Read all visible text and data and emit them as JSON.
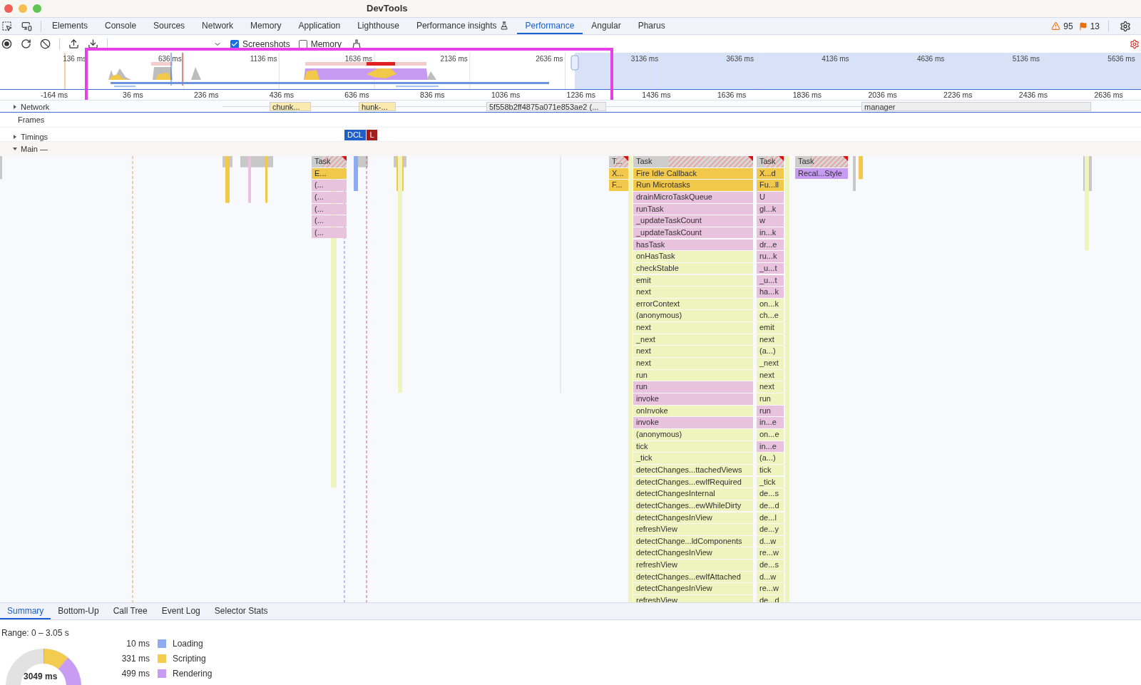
{
  "window": {
    "title": "DevTools"
  },
  "tabs": [
    {
      "label": "Elements",
      "selected": false,
      "kind": "plain"
    },
    {
      "label": "Console",
      "selected": false,
      "kind": "plain"
    },
    {
      "label": "Sources",
      "selected": false,
      "kind": "plain"
    },
    {
      "label": "Network",
      "selected": false,
      "kind": "plain"
    },
    {
      "label": "Memory",
      "selected": false,
      "kind": "plain"
    },
    {
      "label": "Application",
      "selected": false,
      "kind": "plain"
    },
    {
      "label": "Lighthouse",
      "selected": false,
      "kind": "plain"
    },
    {
      "label": "Performance insights",
      "selected": false,
      "kind": "experimental"
    },
    {
      "label": "Performance",
      "selected": true,
      "kind": "plain"
    },
    {
      "label": "Angular",
      "selected": false,
      "kind": "plain"
    },
    {
      "label": "Pharus",
      "selected": false,
      "kind": "plain"
    }
  ],
  "issues": {
    "warnings": "95",
    "messages": "13"
  },
  "toolbar": {
    "options": [
      {
        "label": "Screenshots",
        "checked": true
      },
      {
        "label": "Memory",
        "checked": false
      }
    ]
  },
  "overview": {
    "ticks": [
      "136 ms",
      "636 ms",
      "1136 ms",
      "1636 ms",
      "2136 ms",
      "2636 ms",
      "3136 ms",
      "3636 ms",
      "4136 ms",
      "4636 ms",
      "5136 ms",
      "5636 ms"
    ]
  },
  "ruler": {
    "ticks": [
      "-164 ms",
      "36 ms",
      "236 ms",
      "436 ms",
      "636 ms",
      "836 ms",
      "1036 ms",
      "1236 ms",
      "1436 ms",
      "1636 ms",
      "1836 ms",
      "2036 ms",
      "2236 ms",
      "2436 ms",
      "2636 ms"
    ]
  },
  "tracks": {
    "network": {
      "label": "Network",
      "expanded": false,
      "requests": [
        {
          "label": "chunk..."
        },
        {
          "label": "hunk-..."
        },
        {
          "label": "5f558b2ff4875a071e853ae2 (..."
        },
        {
          "label": "manager"
        }
      ]
    },
    "frames": {
      "label": "Frames"
    },
    "timings": {
      "label": "Timings",
      "expanded": false,
      "markers": [
        {
          "label": "DCL",
          "color": "#1f5fc9"
        },
        {
          "label": "L",
          "color": "#a31b1b"
        }
      ]
    },
    "main": {
      "label": "Main —",
      "expanded": true
    }
  },
  "flame_columns": [
    {
      "entries": [
        {
          "name": "Task",
          "kind": "task",
          "long": true
        },
        {
          "name": "E...",
          "kind": "event"
        },
        {
          "name": "(...",
          "kind": "framework"
        },
        {
          "name": "(...",
          "kind": "framework"
        },
        {
          "name": "(...",
          "kind": "framework"
        },
        {
          "name": "(...",
          "kind": "framework"
        },
        {
          "name": "(...",
          "kind": "framework"
        }
      ]
    },
    {
      "entries": [
        {
          "name": "T...",
          "kind": "task",
          "long": true
        },
        {
          "name": "X...",
          "kind": "event"
        },
        {
          "name": "F...",
          "kind": "event"
        }
      ]
    },
    {
      "entries": [
        {
          "name": "Task",
          "kind": "task",
          "long": true
        },
        {
          "name": "Fire Idle Callback",
          "kind": "event"
        },
        {
          "name": "Run Microtasks",
          "kind": "event"
        },
        {
          "name": "drainMicroTaskQueue",
          "kind": "framework"
        },
        {
          "name": "runTask",
          "kind": "framework"
        },
        {
          "name": "_updateTaskCount",
          "kind": "framework"
        },
        {
          "name": "_updateTaskCount",
          "kind": "framework"
        },
        {
          "name": "hasTask",
          "kind": "framework"
        },
        {
          "name": "onHasTask",
          "kind": "script"
        },
        {
          "name": "checkStable",
          "kind": "script"
        },
        {
          "name": "emit",
          "kind": "script"
        },
        {
          "name": "next",
          "kind": "script"
        },
        {
          "name": "errorContext",
          "kind": "script"
        },
        {
          "name": "(anonymous)",
          "kind": "script"
        },
        {
          "name": "next",
          "kind": "script"
        },
        {
          "name": "_next",
          "kind": "script"
        },
        {
          "name": "next",
          "kind": "script"
        },
        {
          "name": "next",
          "kind": "script"
        },
        {
          "name": "run",
          "kind": "script"
        },
        {
          "name": "run",
          "kind": "framework"
        },
        {
          "name": "invoke",
          "kind": "framework"
        },
        {
          "name": "onInvoke",
          "kind": "script"
        },
        {
          "name": "invoke",
          "kind": "framework"
        },
        {
          "name": "(anonymous)",
          "kind": "script"
        },
        {
          "name": "tick",
          "kind": "script"
        },
        {
          "name": "_tick",
          "kind": "script"
        },
        {
          "name": "detectChanges...ttachedViews",
          "kind": "script"
        },
        {
          "name": "detectChanges...ewIfRequired",
          "kind": "script"
        },
        {
          "name": "detectChangesInternal",
          "kind": "script"
        },
        {
          "name": "detectChanges...ewWhileDirty",
          "kind": "script"
        },
        {
          "name": "detectChangesInView",
          "kind": "script"
        },
        {
          "name": "refreshView",
          "kind": "script"
        },
        {
          "name": "detectChange...ldComponents",
          "kind": "script"
        },
        {
          "name": "detectChangesInView",
          "kind": "script"
        },
        {
          "name": "refreshView",
          "kind": "script"
        },
        {
          "name": "detectChanges...ewIfAttached",
          "kind": "script"
        },
        {
          "name": "detectChangesInView",
          "kind": "script"
        },
        {
          "name": "refreshView",
          "kind": "script"
        }
      ]
    },
    {
      "entries": [
        {
          "name": "Task",
          "kind": "task",
          "long": true
        },
        {
          "name": "X...d",
          "kind": "event"
        },
        {
          "name": "Fu...ll",
          "kind": "event"
        },
        {
          "name": "U",
          "kind": "framework"
        },
        {
          "name": "gl...k",
          "kind": "framework"
        },
        {
          "name": "w",
          "kind": "framework"
        },
        {
          "name": "in...k",
          "kind": "framework"
        },
        {
          "name": "dr...e",
          "kind": "framework"
        },
        {
          "name": "ru...k",
          "kind": "framework"
        },
        {
          "name": "_u...t",
          "kind": "framework"
        },
        {
          "name": "_u...t",
          "kind": "framework"
        },
        {
          "name": "ha...k",
          "kind": "framework"
        },
        {
          "name": "on...k",
          "kind": "script"
        },
        {
          "name": "ch...e",
          "kind": "script"
        },
        {
          "name": "emit",
          "kind": "script"
        },
        {
          "name": "next",
          "kind": "script"
        },
        {
          "name": "(a...)",
          "kind": "script"
        },
        {
          "name": "_next",
          "kind": "script"
        },
        {
          "name": "next",
          "kind": "script"
        },
        {
          "name": "next",
          "kind": "script"
        },
        {
          "name": "run",
          "kind": "script"
        },
        {
          "name": "run",
          "kind": "framework"
        },
        {
          "name": "in...e",
          "kind": "framework"
        },
        {
          "name": "on...e",
          "kind": "script"
        },
        {
          "name": "in...e",
          "kind": "framework"
        },
        {
          "name": "(a...)",
          "kind": "script"
        },
        {
          "name": "tick",
          "kind": "script"
        },
        {
          "name": "_tick",
          "kind": "script"
        },
        {
          "name": "de...s",
          "kind": "script"
        },
        {
          "name": "de...d",
          "kind": "script"
        },
        {
          "name": "de...l",
          "kind": "script"
        },
        {
          "name": "de...y",
          "kind": "script"
        },
        {
          "name": "d...w",
          "kind": "script"
        },
        {
          "name": "re...w",
          "kind": "script"
        },
        {
          "name": "de...s",
          "kind": "script"
        },
        {
          "name": "d...w",
          "kind": "script"
        },
        {
          "name": "re...w",
          "kind": "script"
        },
        {
          "name": "de...d",
          "kind": "script"
        }
      ]
    },
    {
      "entries": [
        {
          "name": "Task",
          "kind": "task",
          "long": true
        },
        {
          "name": "Recal...Style",
          "kind": "rendering"
        }
      ]
    }
  ],
  "bottom": {
    "tabs": [
      {
        "label": "Summary",
        "selected": true
      },
      {
        "label": "Bottom-Up",
        "selected": false
      },
      {
        "label": "Call Tree",
        "selected": false
      },
      {
        "label": "Event Log",
        "selected": false
      },
      {
        "label": "Selector Stats",
        "selected": false
      }
    ],
    "range": "Range: 0 – 3.05 s",
    "total": "3049 ms",
    "legend": [
      {
        "value": "10 ms",
        "label": "Loading",
        "color": "#8cabf0"
      },
      {
        "value": "331 ms",
        "label": "Scripting",
        "color": "#f2cb4f"
      },
      {
        "value": "499 ms",
        "label": "Rendering",
        "color": "#c99cf4"
      }
    ]
  }
}
